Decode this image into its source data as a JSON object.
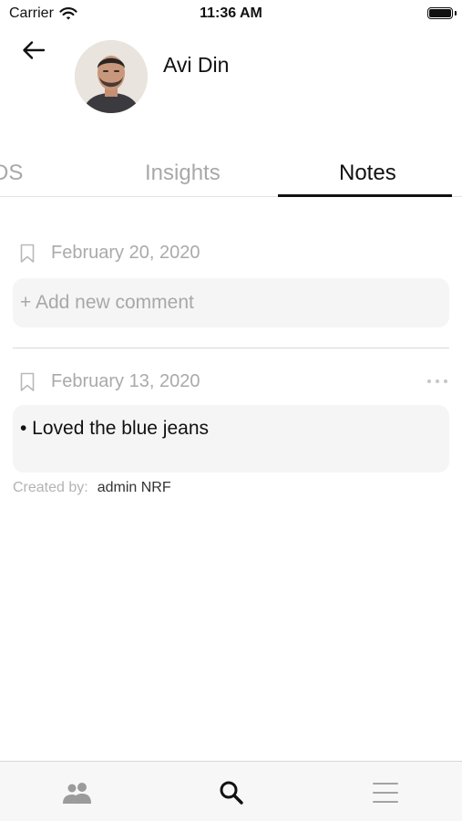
{
  "status_bar": {
    "carrier": "Carrier",
    "time": "11:36 AM",
    "wifi_icon": "wifi-icon",
    "battery_icon": "battery-icon"
  },
  "header": {
    "back_icon": "arrow-left-icon",
    "name": "Avi Din",
    "avatar": "profile-photo"
  },
  "tabs": [
    {
      "label": "DS",
      "active": false
    },
    {
      "label": "Insights",
      "active": false
    },
    {
      "label": "Notes",
      "active": true
    }
  ],
  "notes": {
    "new_note": {
      "date": "February 20, 2020",
      "placeholder": "+ Add new comment",
      "bookmark_icon": "bookmark-icon"
    },
    "entries": [
      {
        "date": "February 13, 2020",
        "text": "• Loved the blue jeans",
        "created_label": "Created by:",
        "created_by": "admin NRF",
        "more_icon": "more-horizontal-icon",
        "bookmark_icon": "bookmark-icon"
      }
    ]
  },
  "bottom_nav": [
    {
      "name": "people-icon",
      "active": false
    },
    {
      "name": "search-icon",
      "active": true
    },
    {
      "name": "menu-icon",
      "active": false
    }
  ],
  "colors": {
    "active_text": "#111111",
    "inactive_text": "#a8a8a8",
    "card_background": "#f5f5f5"
  }
}
